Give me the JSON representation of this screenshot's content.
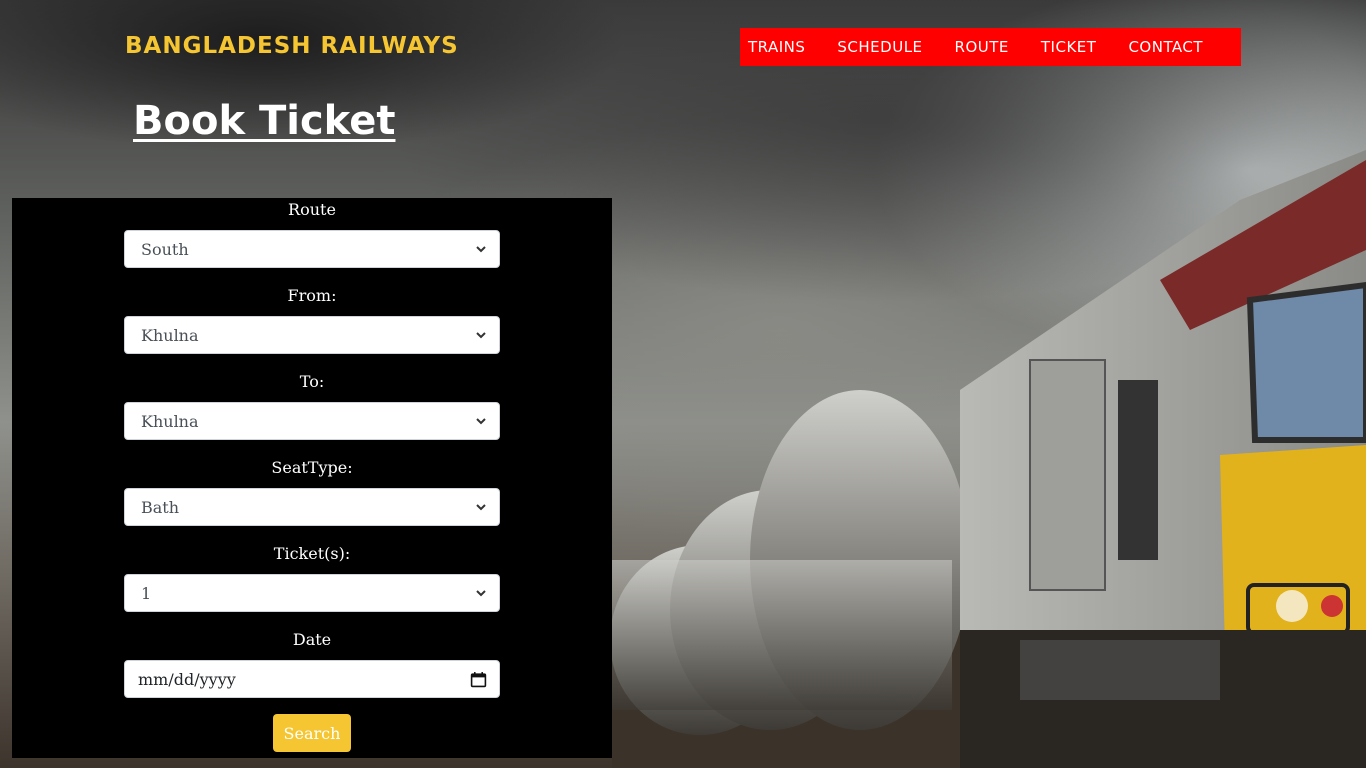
{
  "brand": {
    "name": "BANGLADESH RAILWAYS"
  },
  "nav": {
    "items": [
      {
        "label": "TRAINS"
      },
      {
        "label": "SCHEDULE"
      },
      {
        "label": "ROUTE"
      },
      {
        "label": "TICKET"
      },
      {
        "label": "CONTACT"
      }
    ]
  },
  "page": {
    "title": "Book Ticket"
  },
  "form": {
    "route": {
      "label": "Route",
      "value": "South"
    },
    "from": {
      "label": "From:",
      "value": "Khulna"
    },
    "to": {
      "label": "To:",
      "value": "Khulna"
    },
    "seat_type": {
      "label": "SeatType:",
      "value": "Bath"
    },
    "tickets": {
      "label": "Ticket(s):",
      "value": "1"
    },
    "date": {
      "label": "Date",
      "placeholder": "mm/dd/yyyy"
    },
    "search_label": "Search"
  },
  "colors": {
    "brand": "#f5c632",
    "nav_bg": "#ff0000",
    "panel_bg": "#000000",
    "button": "#f5c632"
  },
  "icons": [
    "chevron-down-icon",
    "calendar-icon"
  ],
  "background": "train-photo"
}
